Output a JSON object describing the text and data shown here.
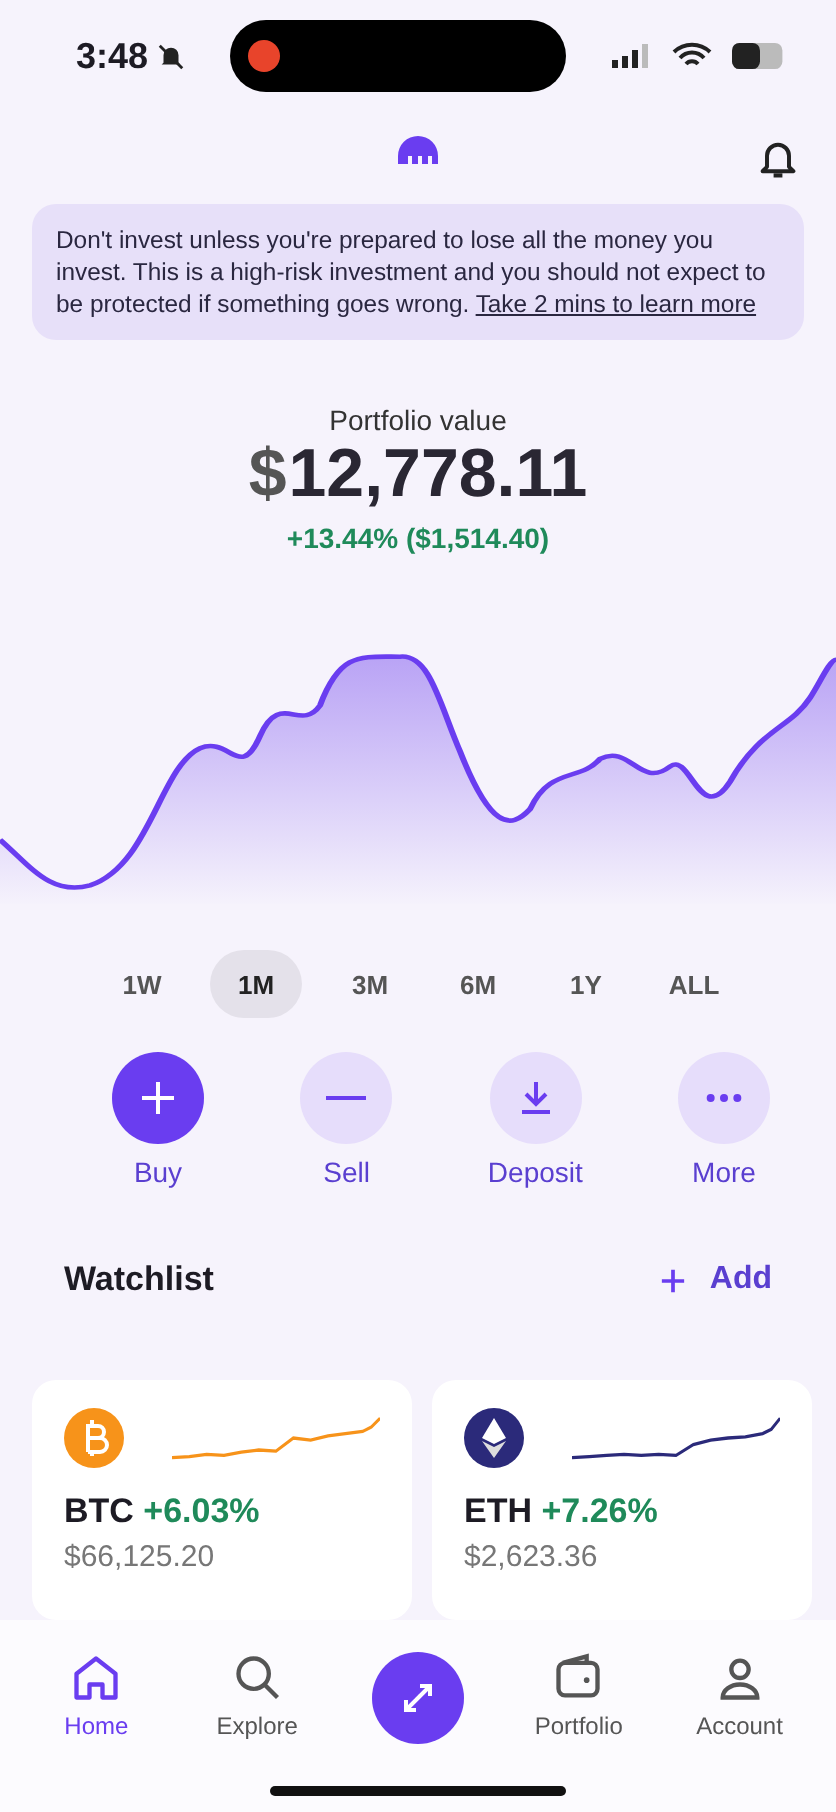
{
  "status_bar": {
    "time": "3:48"
  },
  "banner": {
    "text": "Don't invest unless you're prepared to lose all the money you invest. This is a high-risk investment and you should not expect to be protected if something goes wrong.",
    "link": "Take 2 mins to learn more"
  },
  "portfolio": {
    "label": "Portfolio value",
    "currency": "$",
    "value": "12,778.11",
    "change": "+13.44% ($1,514.40)"
  },
  "periods": [
    {
      "label": "1W",
      "selected": false
    },
    {
      "label": "1M",
      "selected": true
    },
    {
      "label": "3M",
      "selected": false
    },
    {
      "label": "6M",
      "selected": false
    },
    {
      "label": "1Y",
      "selected": false
    },
    {
      "label": "ALL",
      "selected": false
    }
  ],
  "actions": [
    {
      "kind": "buy",
      "label": "Buy",
      "primary": true
    },
    {
      "kind": "sell",
      "label": "Sell",
      "primary": false
    },
    {
      "kind": "deposit",
      "label": "Deposit",
      "primary": false
    },
    {
      "kind": "more",
      "label": "More",
      "primary": false
    }
  ],
  "watchlist": {
    "title": "Watchlist",
    "add": "Add",
    "items": [
      {
        "kind": "btc",
        "symbol": "BTC",
        "change": "+6.03%",
        "price": "$66,125.20",
        "color": "#f7931a"
      },
      {
        "kind": "eth",
        "symbol": "ETH",
        "change": "+7.26%",
        "price": "$2,623.36",
        "color": "#2b2a7a"
      }
    ]
  },
  "nav": [
    {
      "kind": "home",
      "label": "Home",
      "selected": true
    },
    {
      "kind": "explore",
      "label": "Explore",
      "selected": false
    },
    {
      "kind": "trade",
      "selected": false
    },
    {
      "kind": "portfolio",
      "label": "Portfolio",
      "selected": false
    },
    {
      "kind": "account",
      "label": "Account",
      "selected": false
    }
  ]
}
